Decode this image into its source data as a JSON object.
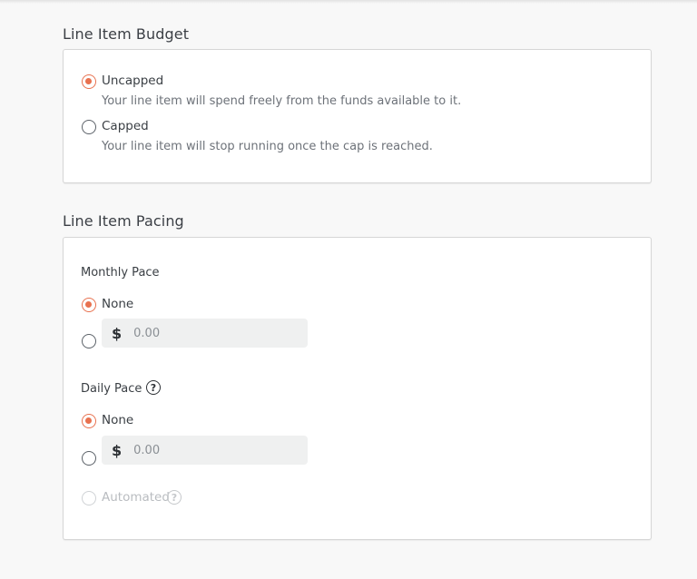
{
  "budget": {
    "title": "Line Item Budget",
    "options": [
      {
        "label": "Uncapped",
        "description": "Your line item will spend freely from the funds available to it.",
        "checked": true
      },
      {
        "label": "Capped",
        "description": "Your line item will stop running once the cap is reached.",
        "checked": false
      }
    ]
  },
  "pacing": {
    "title": "Line Item Pacing",
    "monthly": {
      "label": "Monthly Pace",
      "none_label": "None",
      "none_checked": true,
      "currency_symbol": "$",
      "amount_placeholder": "0.00",
      "amount_value": ""
    },
    "daily": {
      "label": "Daily Pace",
      "help_icon": "question-circle-icon",
      "none_label": "None",
      "none_checked": true,
      "currency_symbol": "$",
      "amount_placeholder": "0.00",
      "amount_value": "",
      "automated_label": "Automated",
      "automated_disabled": true
    }
  },
  "colors": {
    "accent": "#e8714f",
    "background": "#f8f8f8",
    "card": "#ffffff",
    "input_bg": "#eff0f0"
  }
}
